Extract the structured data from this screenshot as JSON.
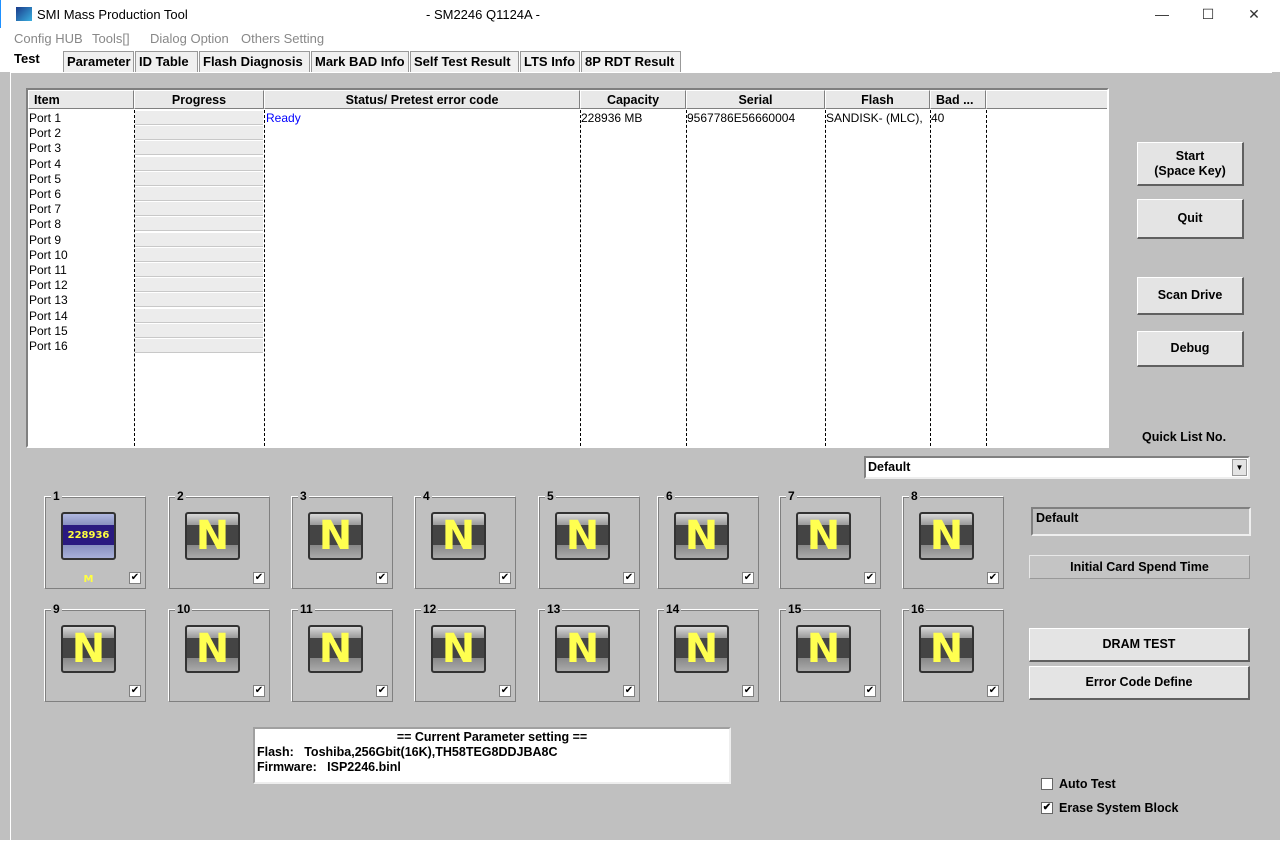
{
  "window": {
    "title": "SMI Mass Production Tool",
    "subtitle": "- SM2246 Q1124A -",
    "minimize": "—",
    "maximize": "☐",
    "close": "✕"
  },
  "menu": [
    "Config HUB",
    "Tools[]",
    "Dialog Option",
    "Others Setting"
  ],
  "tabs": [
    "Test",
    "Parameter",
    "ID Table",
    "Flash Diagnosis",
    "Mark BAD Info",
    "Self Test Result",
    "LTS Info",
    "8P RDT Result"
  ],
  "table": {
    "columns": [
      "Item",
      "Progress",
      "Status/ Pretest error code",
      "Capacity",
      "Serial",
      "Flash",
      "Bad ..."
    ],
    "rows": [
      {
        "item": "Port 1",
        "status": "Ready",
        "capacity": "228936 MB",
        "serial": "9567786E56660004",
        "flash": "SANDISK- (MLC), ",
        "bad": "40"
      },
      {
        "item": "Port 2"
      },
      {
        "item": "Port 3"
      },
      {
        "item": "Port 4"
      },
      {
        "item": "Port 5"
      },
      {
        "item": "Port 6"
      },
      {
        "item": "Port 7"
      },
      {
        "item": "Port 8"
      },
      {
        "item": "Port 9"
      },
      {
        "item": "Port 10"
      },
      {
        "item": "Port 11"
      },
      {
        "item": "Port 12"
      },
      {
        "item": "Port 13"
      },
      {
        "item": "Port 14"
      },
      {
        "item": "Port 15"
      },
      {
        "item": "Port 16"
      }
    ],
    "status_color": "#0000ff"
  },
  "ports": [
    {
      "num": "1",
      "label": "228936 M",
      "checked": true
    },
    {
      "num": "2",
      "label": "N",
      "checked": true
    },
    {
      "num": "3",
      "label": "N",
      "checked": true
    },
    {
      "num": "4",
      "label": "N",
      "checked": true
    },
    {
      "num": "5",
      "label": "N",
      "checked": true
    },
    {
      "num": "6",
      "label": "N",
      "checked": true
    },
    {
      "num": "7",
      "label": "N",
      "checked": true
    },
    {
      "num": "8",
      "label": "N",
      "checked": true
    },
    {
      "num": "9",
      "label": "N",
      "checked": true
    },
    {
      "num": "10",
      "label": "N",
      "checked": true
    },
    {
      "num": "11",
      "label": "N",
      "checked": true
    },
    {
      "num": "12",
      "label": "N",
      "checked": true
    },
    {
      "num": "13",
      "label": "N",
      "checked": true
    },
    {
      "num": "14",
      "label": "N",
      "checked": true
    },
    {
      "num": "15",
      "label": "N",
      "checked": true
    },
    {
      "num": "16",
      "label": "N",
      "checked": true
    }
  ],
  "buttons": {
    "start": "Start\n(Space Key)",
    "quit": "Quit",
    "scan": "Scan Drive",
    "debug": "Debug",
    "initial_card": "Initial Card Spend Time",
    "dram": "DRAM TEST",
    "error_code": "Error Code Define"
  },
  "quick_list": {
    "label": "Quick List No.",
    "value": "Default"
  },
  "default_box": "Default",
  "param": {
    "header": "== Current Parameter setting ==",
    "flash": "Flash:   Toshiba,256Gbit(16K),TH58TEG8DDJBA8C",
    "firmware": "Firmware:   ISP2246.binl"
  },
  "options": {
    "auto_test": {
      "label": "Auto Test",
      "checked": false
    },
    "erase": {
      "label": "Erase System Block",
      "checked": true
    }
  }
}
